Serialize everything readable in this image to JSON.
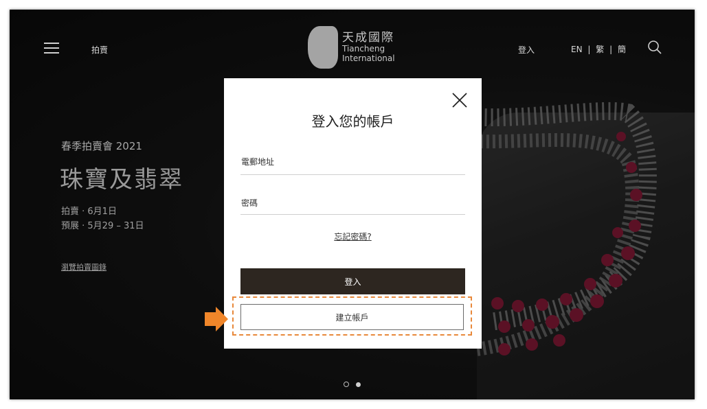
{
  "header": {
    "menu_icon": "hamburger-menu-icon",
    "nav_auction": "拍賣",
    "logo": {
      "cn": "天成國際",
      "en_line1": "Tiancheng",
      "en_line2": "International"
    },
    "login": "登入",
    "languages": [
      "EN",
      "繁",
      "簡"
    ],
    "language_separator": "|",
    "search_icon": "search-icon"
  },
  "hero": {
    "season": "春季拍賣會 2021",
    "title": "珠寶及翡翠",
    "auction_date": "拍賣 · 6月1日",
    "preview_date": "預展 · 5月29 – 31日",
    "browse_link": "瀏覽拍賣圖錄",
    "carousel": {
      "total": 2,
      "active": 2
    }
  },
  "modal": {
    "title": "登入您的帳戶",
    "email_label": "電郵地址",
    "email_value": "",
    "password_label": "密碼",
    "password_value": "",
    "forgot_link": "忘記密碼?",
    "login_button": "登入",
    "create_button": "建立帳戶",
    "close_icon": "close-icon"
  },
  "colors": {
    "login_button_bg": "#2d2620",
    "highlight_accent": "#e8883a",
    "background": "#121212"
  }
}
